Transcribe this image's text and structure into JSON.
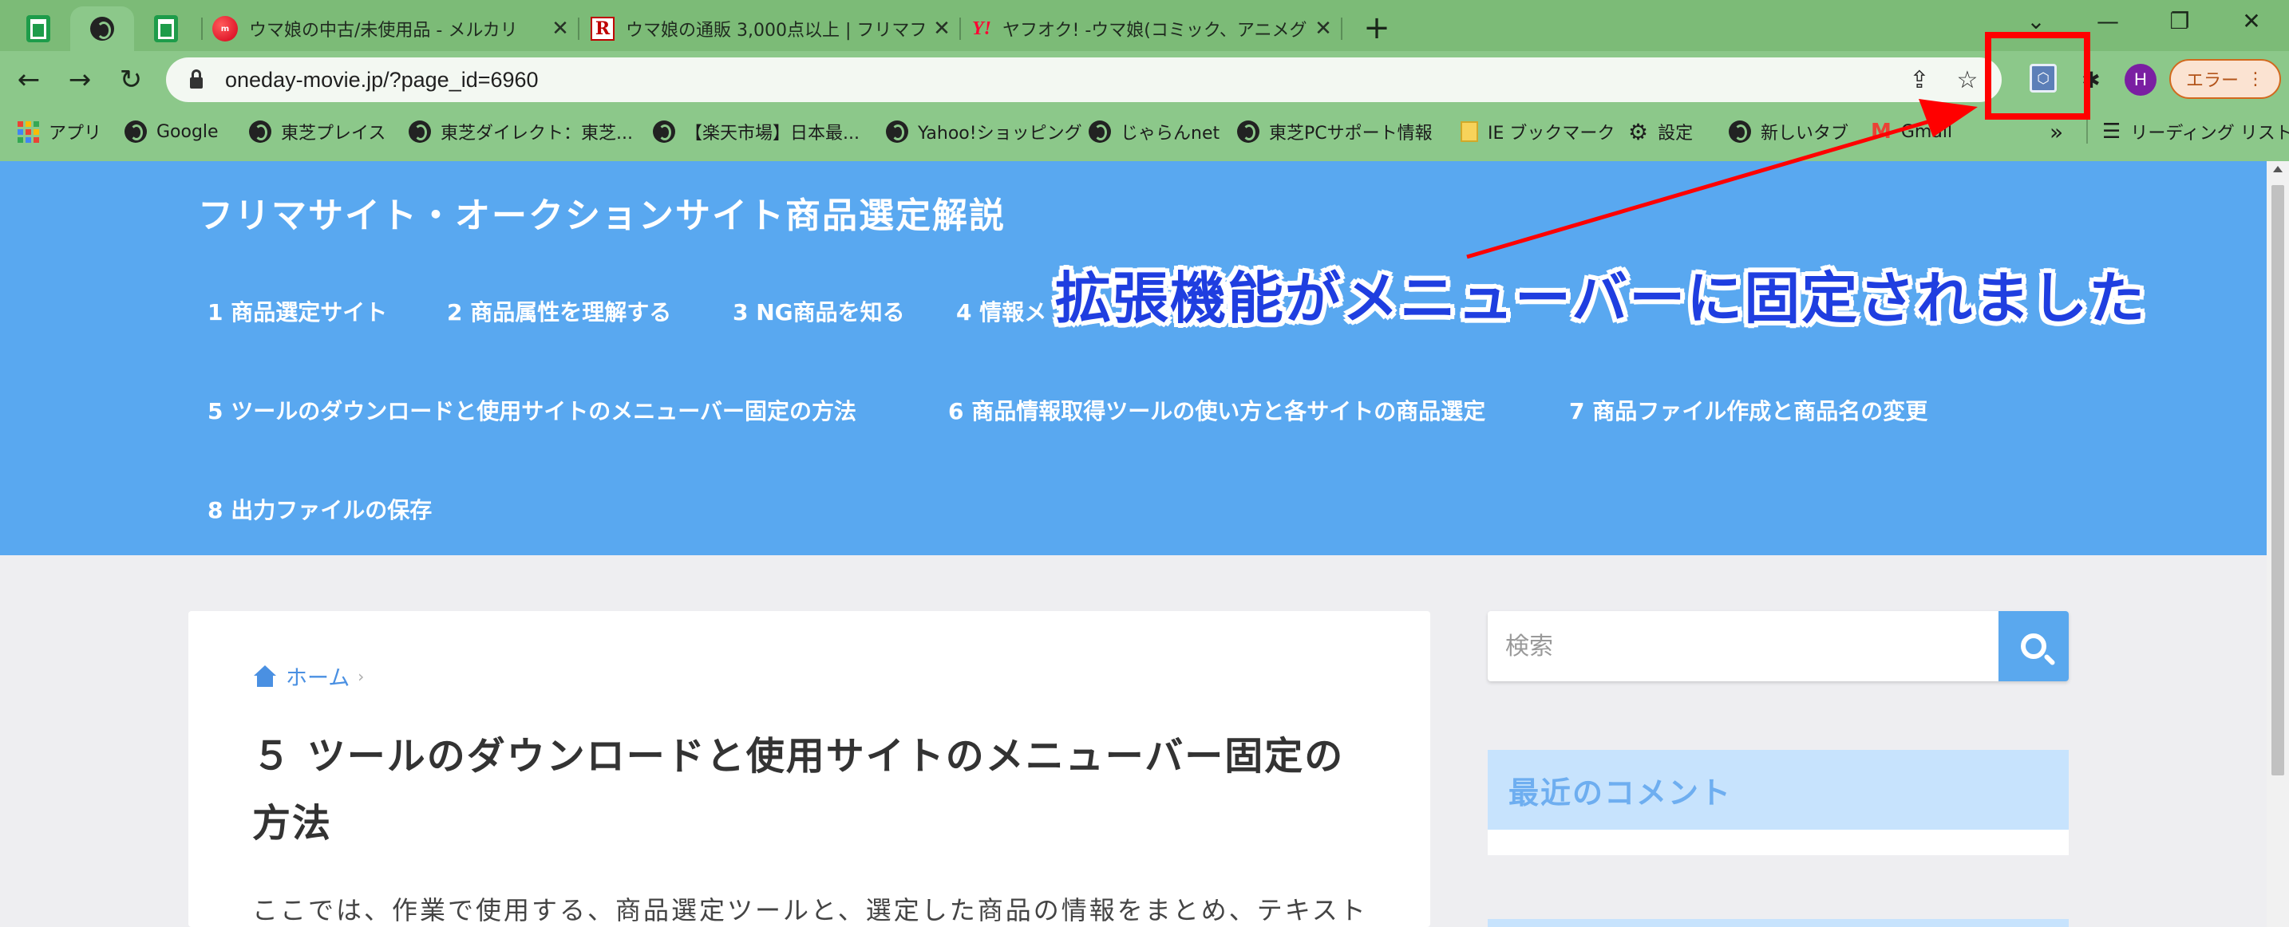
{
  "browser": {
    "tabs": [
      {
        "kind": "pinned",
        "icon": "sheets-icon"
      },
      {
        "kind": "pinned",
        "icon": "globe-icon",
        "active": true
      },
      {
        "kind": "pinned",
        "icon": "sheets-icon"
      },
      {
        "title": "ウマ娘の中古/未使用品 - メルカリ",
        "icon": "mercari-icon"
      },
      {
        "title": "ウマ娘の通販 3,000点以上 | フリマフ",
        "icon": "rakuten-icon"
      },
      {
        "title": "ヤフオク! -ウマ娘(コミック、アニメグッズ",
        "icon": "yahoo-icon"
      }
    ],
    "tab_close_glyph": "✕",
    "new_tab_glyph": "+",
    "window_controls": {
      "tab_search": "⌄",
      "minimize": "—",
      "restore": "❐",
      "close": "✕"
    },
    "nav": {
      "back": "←",
      "forward": "→",
      "reload": "↻"
    },
    "url": "oneday-movie.jp/?page_id=6960",
    "share_glyph": "⇪",
    "star_glyph": "☆",
    "extension_glyph": "⬡",
    "puzzle_glyph": "✱",
    "profile_initial": "H",
    "error_label": "エラー",
    "error_menu_glyph": "⋮",
    "bookmarks": [
      {
        "label": "アプリ",
        "icon": "apps-icon"
      },
      {
        "label": "Google",
        "icon": "globe-icon"
      },
      {
        "label": "東芝プレイス",
        "icon": "globe-icon"
      },
      {
        "label": "東芝ダイレクト：東芝...",
        "icon": "globe-icon"
      },
      {
        "label": "【楽天市場】日本最...",
        "icon": "globe-icon"
      },
      {
        "label": "Yahoo!ショッピング",
        "icon": "globe-icon"
      },
      {
        "label": "じゃらんnet",
        "icon": "globe-icon"
      },
      {
        "label": "東芝PCサポート情報",
        "icon": "globe-icon"
      },
      {
        "label": "IE ブックマーク",
        "icon": "folder-icon"
      },
      {
        "label": "設定",
        "icon": "gear-icon"
      },
      {
        "label": "新しいタブ",
        "icon": "globe-icon"
      },
      {
        "label": "Gmail",
        "icon": "gmail-icon"
      }
    ],
    "bookmarks_more": "»",
    "reading_list": {
      "label": "リーディング リスト",
      "icon": "reading-list-icon"
    },
    "colors": {
      "frame": "#8cc88a",
      "tabstrip": "#7cbb77",
      "highlight": "#ff0000"
    }
  },
  "page": {
    "site_title": "フリマサイト・オークションサイト商品選定解説",
    "menu": [
      "1 商品選定サイト",
      "2 商品属性を理解する",
      "3 NG商品を知る",
      "4 情報メ",
      "5 ツールのダウンロードと使用サイトのメニューバー固定の方法",
      "6 商品情報取得ツールの使い方と各サイトの商品選定",
      "7 商品ファイル作成と商品名の変更",
      "8 出力ファイルの保存"
    ],
    "annotation": "拡張機能がメニューバーに固定されました",
    "breadcrumb": {
      "home": "ホーム",
      "separator": "›"
    },
    "post_title": "５ ツールのダウンロードと使用サイトのメニューバー固定の方法",
    "post_body": "ここでは、作業で使用する、商品選定ツールと、選定した商品の情報をまとめ、テキスト",
    "search_placeholder": "検索",
    "widget_title": "最近のコメント",
    "colors": {
      "header": "#59a8f0",
      "annotation_text": "#1f3ee0",
      "link": "#4a90e2",
      "widget_bg": "#c7e3fd"
    }
  }
}
